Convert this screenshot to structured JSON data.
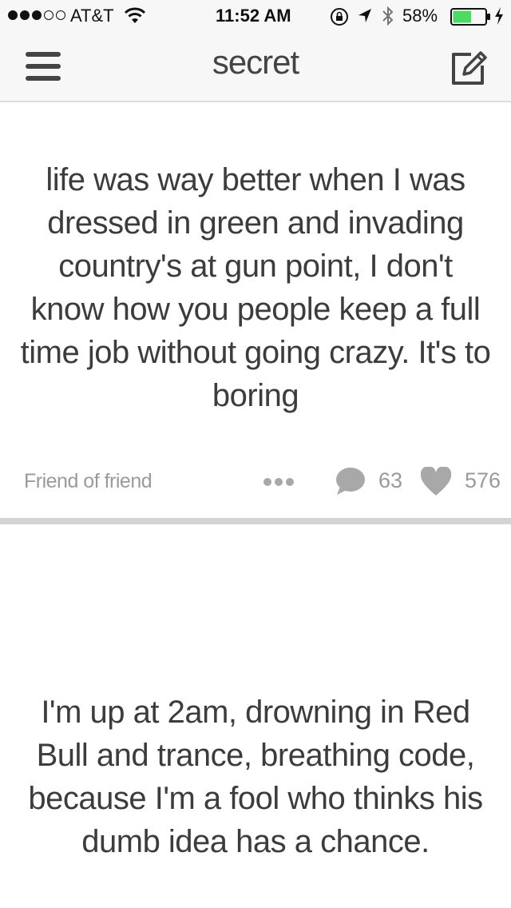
{
  "status_bar": {
    "carrier": "AT&T",
    "time": "11:52 AM",
    "battery_percent": "58%",
    "battery_level": 0.58,
    "signal_bars_filled": 3,
    "signal_bars_total": 5
  },
  "nav": {
    "title": "secret"
  },
  "feed": [
    {
      "text": "life was way better when I was dressed in green and invading country's at gun point, I don't know how you people keep a full time job without going crazy. It's to boring",
      "source": "Friend of friend",
      "comments": "63",
      "likes": "576"
    },
    {
      "text": "I'm up at 2am, drowning in Red Bull and trance, breathing code, because I'm a fool who thinks his dumb idea has a chance."
    }
  ],
  "colors": {
    "bar_background": "#f7f7f7",
    "text": "#3c3c3c",
    "muted": "#9a9a9a",
    "battery_fill": "#4cd964"
  }
}
